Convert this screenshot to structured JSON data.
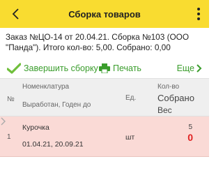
{
  "header": {
    "title": "Сборка товаров",
    "back_icon": "chevron-left-icon",
    "menu_icon": "more-vertical-icon"
  },
  "order_info": "Заказ №ЦО-14 от 20.04.21. Сборка №103 (ООО \"Панда\"). Итого кол-во: 5,00. Собрано: 0,00",
  "actions": {
    "finish_label": "Завершить сборку",
    "print_label": "Печать",
    "more_label": "Еще"
  },
  "table": {
    "headers": {
      "number": "№",
      "nomenclature": "Номенклатура",
      "produced": "Выработан, Годен до",
      "unit": "Ед.",
      "quantity": "Кол-во",
      "collected": "Собрано",
      "weight": "Вес"
    },
    "rows": [
      {
        "number": "1",
        "name": "Курочка",
        "dates": "01.04.21, 20.09.21",
        "unit": "шт",
        "quantity": "5",
        "collected": "0"
      }
    ]
  },
  "colors": {
    "topbar": "#f9dc30",
    "accent_green": "#3a9d2c",
    "row_highlight": "#fadad6",
    "collected_red": "#e02020"
  }
}
